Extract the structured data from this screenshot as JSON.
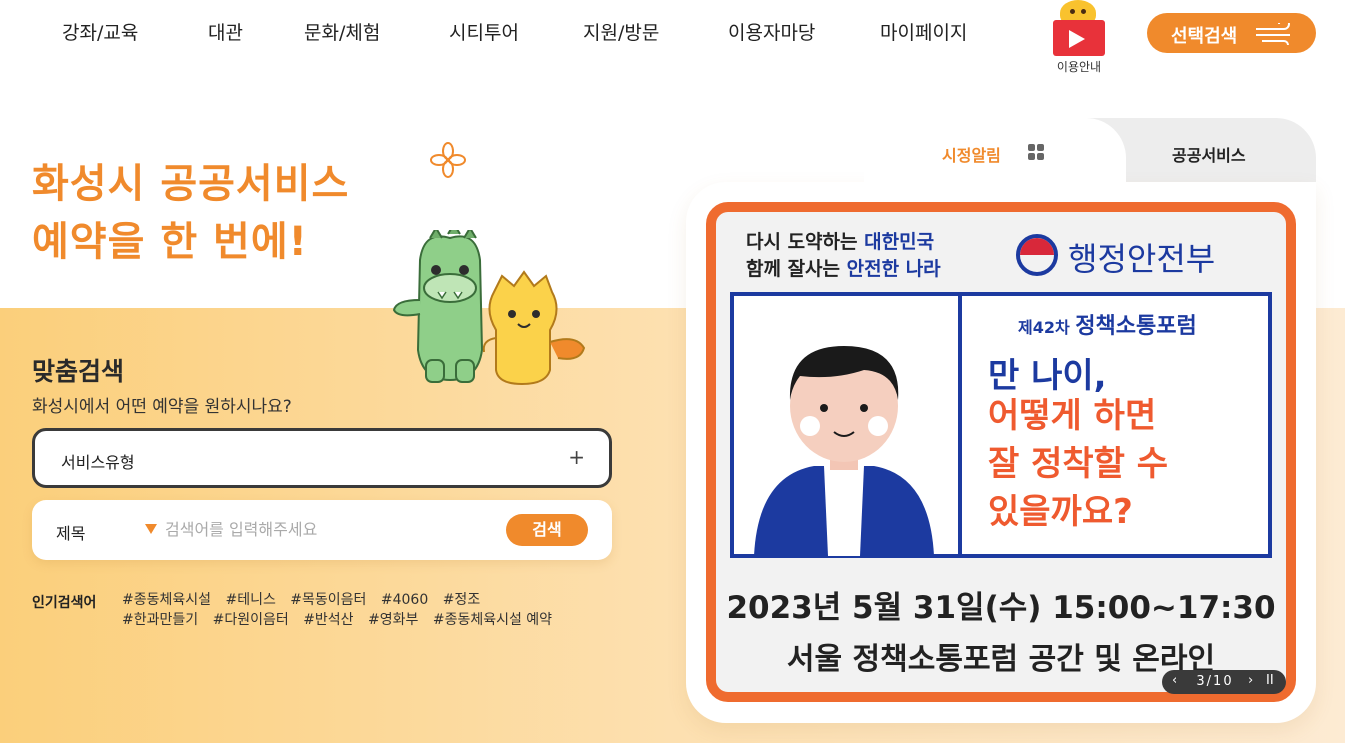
{
  "nav": {
    "items": [
      "강좌/교육",
      "대관",
      "문화/체험",
      "시티투어",
      "지원/방문",
      "이용자마당",
      "마이페이지"
    ],
    "guide_label": "이용안내",
    "select_search": "선택검색"
  },
  "hero": {
    "title_line1": "화성시 공공서비스",
    "title_line2": "예약을 한 번에!"
  },
  "search": {
    "title": "맞춤검색",
    "subtitle": "화성시에서 어떤 예약을 원하시나요?",
    "type_label": "서비스유형",
    "type_plus": "+",
    "query_label": "제목",
    "query_placeholder": "검색어를 입력해주세요",
    "query_button": "검색",
    "popular_label": "인기검색어",
    "popular_tags": [
      "#종동체육시설",
      "#테니스",
      "#목동이음터",
      "#4060",
      "#정조",
      "#한과만들기",
      "#다원이음터",
      "#반석산",
      "#영화부",
      "#종동체육시설 예약"
    ]
  },
  "panel": {
    "tab_active": "시정알림",
    "tab_inactive": "공공서비스",
    "banner": {
      "top_line1_a": "다시 도약하는 ",
      "top_line1_b": "대한민국",
      "top_line2_a": "함께 잘사는 ",
      "top_line2_b": "안전한 나라",
      "ministry": "행정안전부",
      "forum_no": "제42차",
      "forum_name": "정책소통포럼",
      "question1": "만 나이,",
      "question2": "어떻게 하면\n잘 정착할 수\n있을까요?",
      "date": "2023년 5월 31일(수) 15:00~17:30",
      "place": "서울 정책소통포럼 공간 및 온라인"
    },
    "pager": {
      "prev": "‹",
      "count": "3/10",
      "next": "›",
      "pause": "II"
    }
  },
  "colors": {
    "accent": "#f08a2c",
    "banner_border": "#ef6b2f",
    "banner_blue": "#1c3aa0"
  }
}
